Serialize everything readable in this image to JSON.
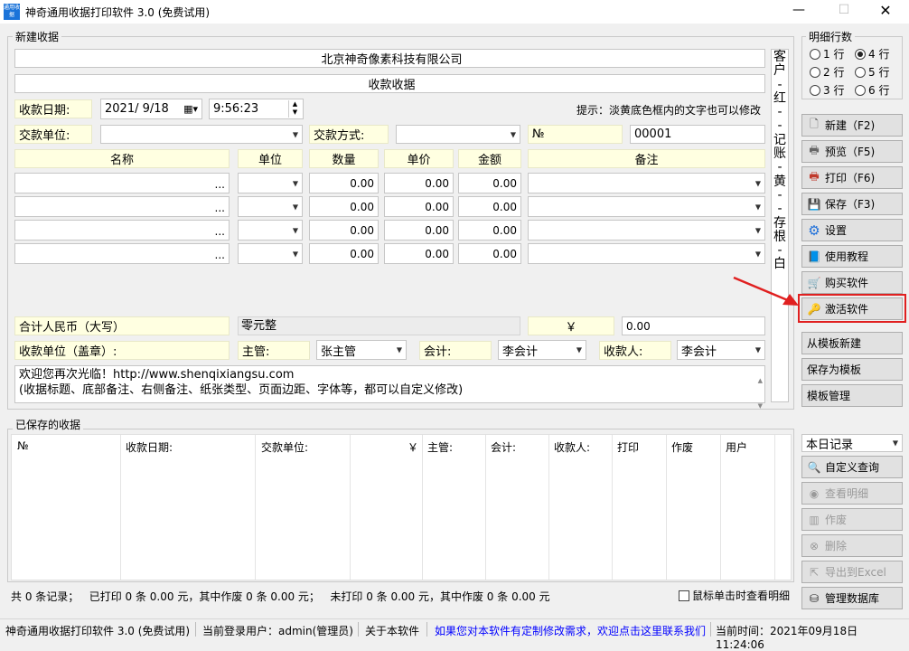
{
  "window": {
    "title": "神奇通用收据打印软件 3.0 (免费试用)",
    "app_icon_text": "通用收据"
  },
  "receipt": {
    "group_label": "新建收据",
    "company": "北京神奇像素科技有限公司",
    "doc_title": "收款收据",
    "date_label": "收款日期:",
    "date_value": "2021/  9/18",
    "time_value": "9:56:23",
    "hint": "提示：淡黄底色框内的文字也可以修改",
    "payer_label": "交款单位:",
    "payer_value": "",
    "method_label": "交款方式:",
    "method_value": "",
    "no_label": "№",
    "no_value": "00001",
    "columns": [
      "名称",
      "单位",
      "数量",
      "单价",
      "金额",
      "备注"
    ],
    "rows": [
      {
        "name": "",
        "unit": "",
        "qty": "0.00",
        "price": "0.00",
        "amount": "0.00",
        "note": ""
      },
      {
        "name": "",
        "unit": "",
        "qty": "0.00",
        "price": "0.00",
        "amount": "0.00",
        "note": ""
      },
      {
        "name": "",
        "unit": "",
        "qty": "0.00",
        "price": "0.00",
        "amount": "0.00",
        "note": ""
      },
      {
        "name": "",
        "unit": "",
        "qty": "0.00",
        "price": "0.00",
        "amount": "0.00",
        "note": ""
      }
    ],
    "total_label": "合计人民币（大写）",
    "total_words": "零元整",
    "yuan_symbol": "￥",
    "total_value": "0.00",
    "stamp_label": "收款单位（盖章）:",
    "supervisor_label": "主管:",
    "supervisor_value": "张主管",
    "accountant_label": "会计:",
    "accountant_value": "李会计",
    "cashier_label": "收款人:",
    "cashier_value": "李会计",
    "memo_line1": "欢迎您再次光临！http://www.shenqixiangsu.com",
    "memo_line2": "(收据标题、底部备注、右侧备注、纸张类型、页面边距、字体等，都可以自定义修改)",
    "side_note": [
      "客",
      "户",
      "-",
      "红",
      "-",
      "-",
      "记",
      "账",
      "-",
      "黄",
      "-",
      "-",
      "存",
      "根",
      "-",
      "白"
    ]
  },
  "detail_rows": {
    "label": "明细行数",
    "options": [
      {
        "label": "1 行",
        "checked": false
      },
      {
        "label": "4 行",
        "checked": true
      },
      {
        "label": "2 行",
        "checked": false
      },
      {
        "label": "5 行",
        "checked": false
      },
      {
        "label": "3 行",
        "checked": false
      },
      {
        "label": "6 行",
        "checked": false
      }
    ]
  },
  "buttons": {
    "new": "新建（F2)",
    "preview": "预览（F5)",
    "print": "打印（F6)",
    "save": "保存（F3)",
    "settings": "设置",
    "tutorial": "使用教程",
    "buy": "购买软件",
    "activate": "激活软件",
    "from_template": "从模板新建",
    "save_template": "保存为模板",
    "template_mgmt": "模板管理",
    "custom_query": "自定义查询",
    "view_detail": "查看明细",
    "void": "作废",
    "delete": "删除",
    "export_excel": "导出到Excel",
    "manage_db": "管理数据库"
  },
  "saved": {
    "label": "已保存的收据",
    "columns": [
      "№",
      "收款日期:",
      "交款单位:",
      "￥",
      "主管:",
      "会计:",
      "收款人:",
      "打印",
      "作废",
      "用户"
    ],
    "filter_value": "本日记录",
    "stats": "共 0 条记录；   已打印 0 条 0.00 元，其中作废 0 条 0.00 元；   未打印 0 条 0.00 元，其中作废 0 条 0.00 元",
    "click_label": "鼠标单击时查看明细"
  },
  "statusbar": {
    "app": "神奇通用收据打印软件 3.0 (免费试用)",
    "user": "当前登录用户：admin(管理员)",
    "about": "关于本软件",
    "contact": "如果您对本软件有定制修改需求，欢迎点击这里联系我们",
    "time": "当前时间：2021年09月18日 11:24:06"
  },
  "colors": {
    "yellow_label": "#ffffe1",
    "link_blue": "#0000ff",
    "highlight_red": "#e02020"
  }
}
